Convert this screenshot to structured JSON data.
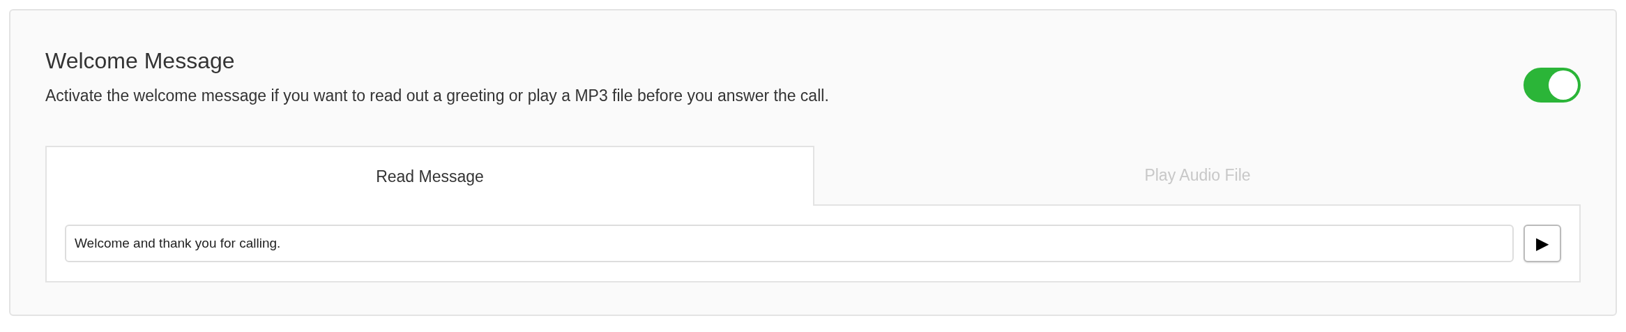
{
  "title": "Welcome Message",
  "description": "Activate the welcome message if you want to read out a greeting or play a MP3 file before you answer the call.",
  "toggle": {
    "on": true
  },
  "tabs": [
    {
      "label": "Read Message",
      "selected": true
    },
    {
      "label": "Play Audio File",
      "selected": false
    }
  ],
  "message_field": {
    "value": "Welcome and thank you for calling."
  },
  "play_button": {
    "label": "▶"
  }
}
